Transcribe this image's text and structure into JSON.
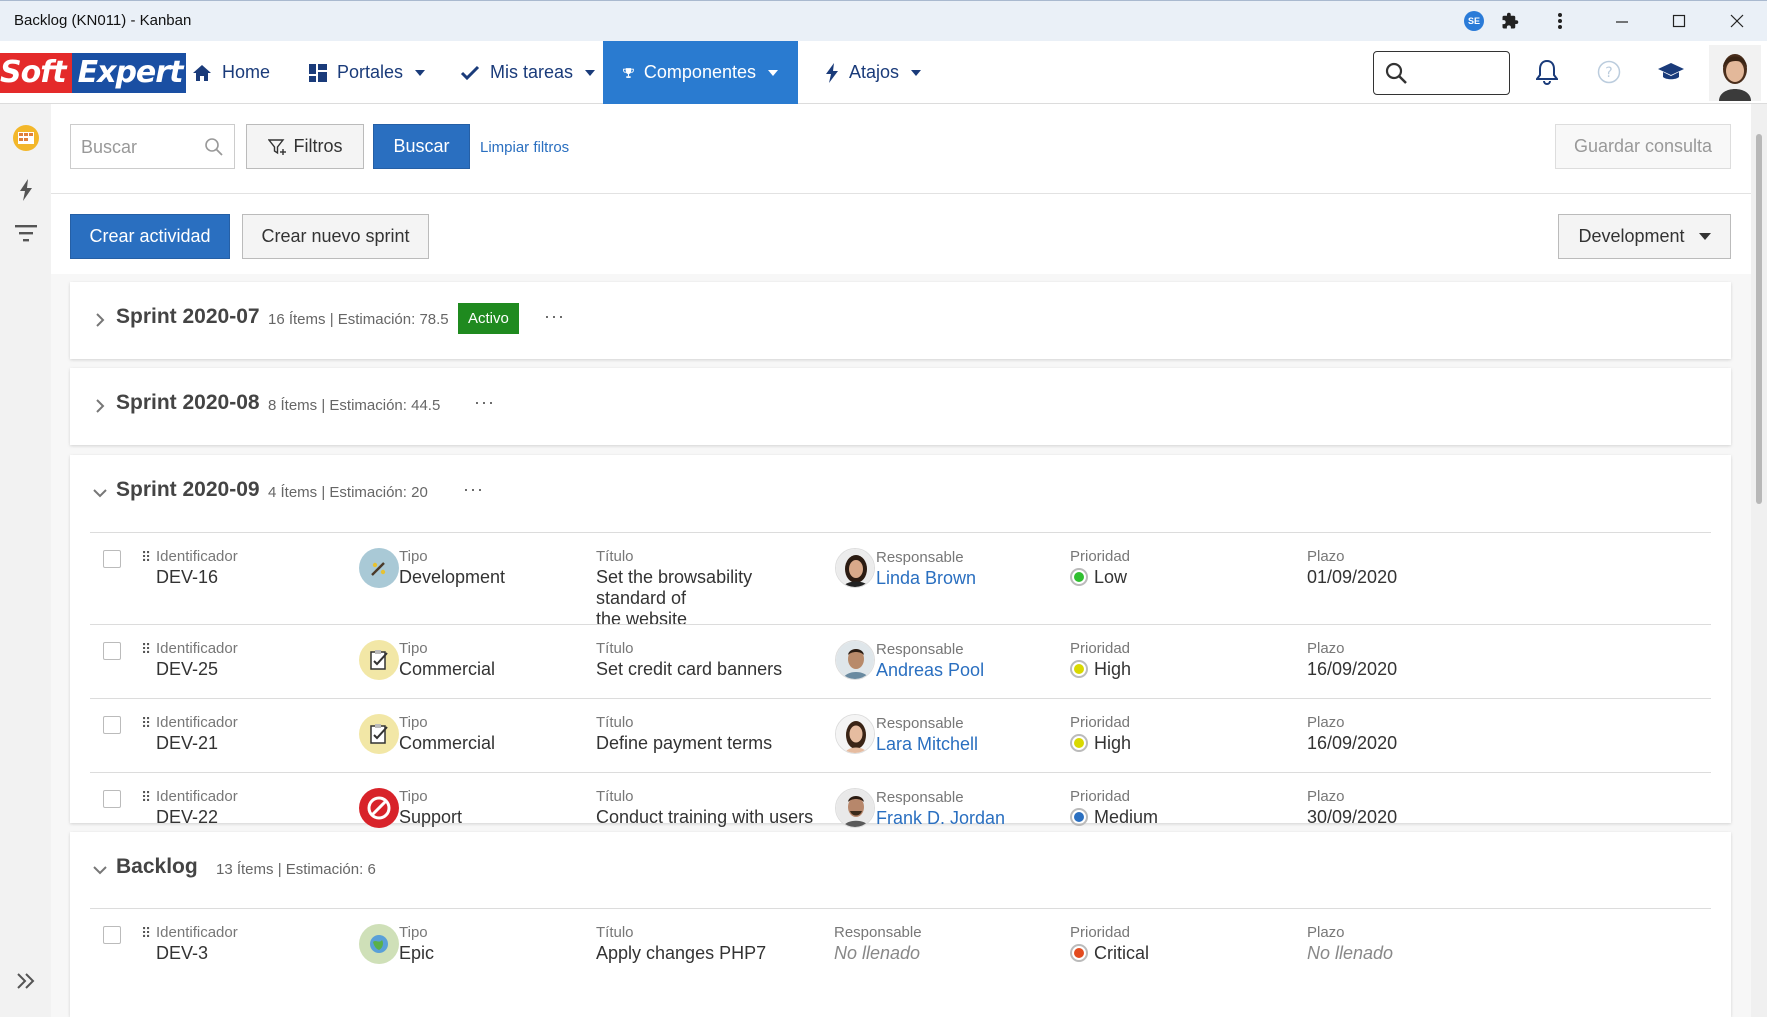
{
  "window": {
    "title": "Backlog (KN011) - Kanban",
    "se_badge": "SE"
  },
  "logo": {
    "part1": "Soft",
    "part2": "Expert"
  },
  "nav": {
    "items": [
      {
        "label": "Home",
        "icon": "home-icon"
      },
      {
        "label": "Portales",
        "icon": "portals-icon"
      },
      {
        "label": "Mis tareas",
        "icon": "check-icon"
      },
      {
        "label": "Componentes",
        "icon": "trophy-icon"
      },
      {
        "label": "Atajos",
        "icon": "bolt-icon"
      }
    ]
  },
  "toolbar": {
    "search_placeholder": "Buscar",
    "filters_label": "Filtros",
    "search_button": "Buscar",
    "clear_filters": "Limpiar filtros",
    "save_query": "Guardar consulta",
    "create_activity": "Crear actividad",
    "create_sprint": "Crear nuevo sprint",
    "development": "Development"
  },
  "labels": {
    "id": "Identificador",
    "type": "Tipo",
    "title": "Título",
    "responsible": "Responsable",
    "priority": "Prioridad",
    "deadline": "Plazo"
  },
  "sprints": [
    {
      "name": "Sprint 2020-07",
      "meta": "16 Ítems | Estimación: 78.5",
      "badge": "Activo",
      "dots": "···"
    },
    {
      "name": "Sprint 2020-08",
      "meta": "8 Ítems | Estimación: 44.5",
      "dots": "···"
    },
    {
      "name": "Sprint 2020-09",
      "meta": "4 Ítems | Estimación: 20",
      "dots": "···",
      "rows": [
        {
          "id": "DEV-16",
          "type": "Development",
          "title1": "Set the browsability standard of",
          "title2": "the website",
          "resp": "Linda Brown",
          "prio": "Low",
          "prio_color": "#2fbf2f",
          "deadline": "01/09/2020"
        },
        {
          "id": "DEV-25",
          "type": "Commercial",
          "title1": "Set credit card banners",
          "resp": "Andreas Pool",
          "prio": "High",
          "prio_color": "#d9d900",
          "deadline": "16/09/2020"
        },
        {
          "id": "DEV-21",
          "type": "Commercial",
          "title1": "Define payment terms",
          "resp": "Lara Mitchell",
          "prio": "High",
          "prio_color": "#d9d900",
          "deadline": "16/09/2020"
        },
        {
          "id": "DEV-22",
          "type": "Support",
          "title1": "Conduct training with users",
          "resp": "Frank D. Jordan",
          "prio": "Medium",
          "prio_color": "#2a6fc0",
          "deadline": "30/09/2020"
        }
      ]
    },
    {
      "name": "Backlog",
      "meta": "13 Ítems | Estimación: 6",
      "rows": [
        {
          "id": "DEV-3",
          "type": "Epic",
          "title1": "Apply changes PHP7",
          "resp": "No llenado",
          "prio": "Critical",
          "prio_color": "#e34b1f",
          "deadline": "No llenado"
        }
      ]
    }
  ]
}
